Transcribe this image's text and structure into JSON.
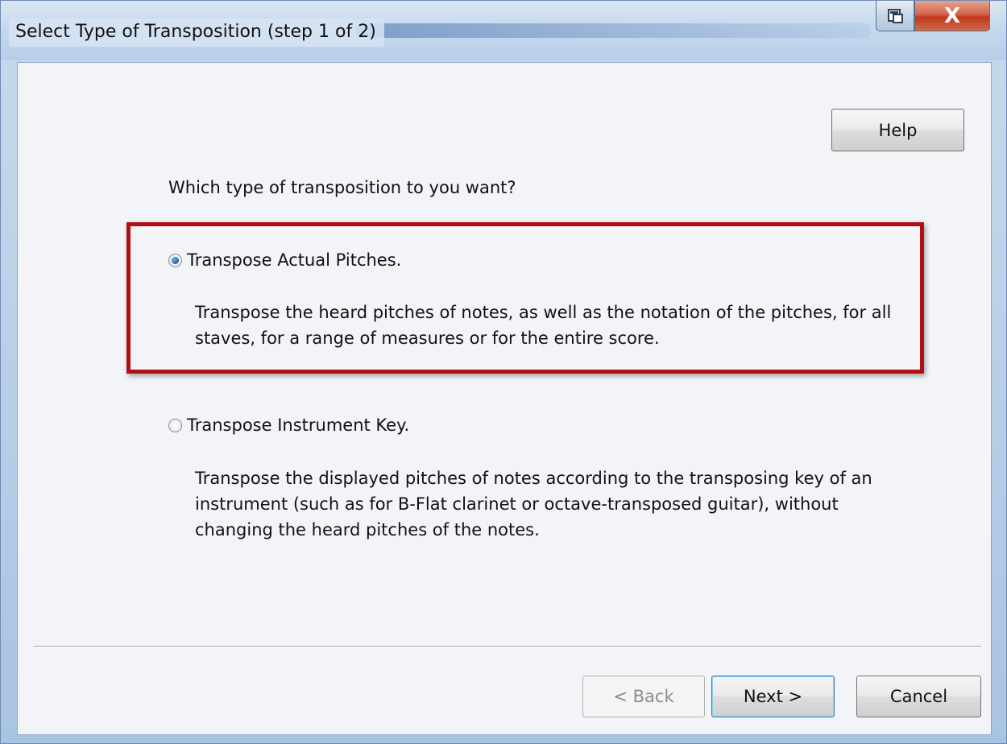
{
  "window": {
    "title": "Select Type of Transposition (step 1 of 2)",
    "close_glyph": "X"
  },
  "help_label": "Help",
  "question": "Which type of transposition to you want?",
  "options": [
    {
      "label": "Transpose Actual Pitches.",
      "selected": true,
      "description_lines": [
        "Transpose the heard pitches of notes, as well as the notation of the pitches, for all",
        "staves, for a range of measures or for the entire score."
      ]
    },
    {
      "label": "Transpose Instrument Key.",
      "selected": false,
      "description_lines": [
        "Transpose the displayed pitches of notes according to the transposing key of an",
        "instrument (such as for B-Flat clarinet or octave-transposed guitar), without",
        "changing the heard pitches of the notes."
      ]
    }
  ],
  "footer": {
    "back_label": "< Back",
    "next_label": "Next >",
    "cancel_label": "Cancel"
  },
  "highlight_color": "#b20e14"
}
